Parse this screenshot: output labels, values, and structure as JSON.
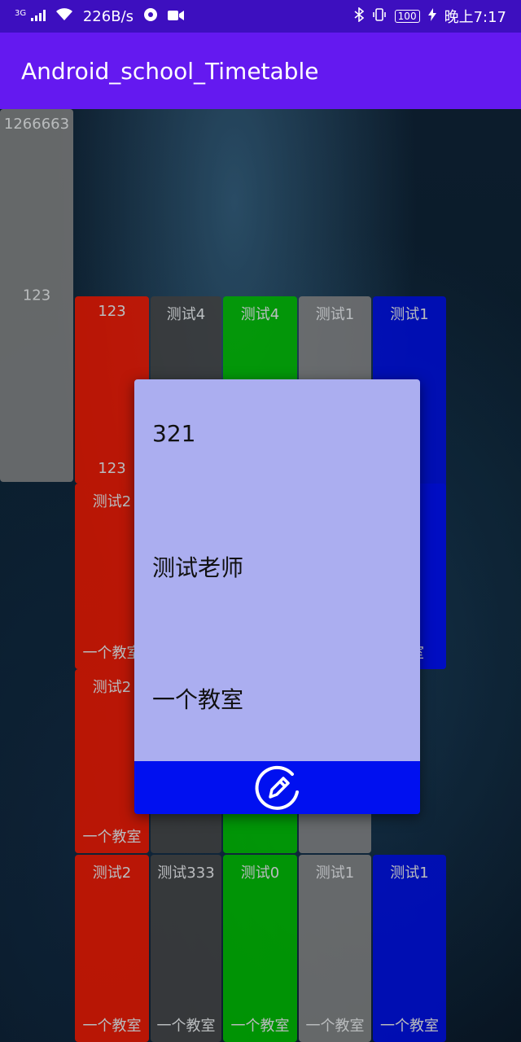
{
  "status_bar": {
    "network_type": "3G",
    "speed": "226B/s",
    "battery": "100",
    "time": "晚上7:17"
  },
  "app_bar": {
    "title": "Android_school_Timetable"
  },
  "timetable": {
    "cells": [
      {
        "top": "1266663",
        "mid": "123",
        "bot": "",
        "color": "#8c8c8c"
      },
      {
        "top": "123",
        "mid": "",
        "bot": "123",
        "color": "#ff1a00"
      },
      {
        "top": "测试4",
        "mid": "",
        "bot": "",
        "color": "#4a4a4a"
      },
      {
        "top": "测试4",
        "mid": "",
        "bot": "",
        "color": "#00c800"
      },
      {
        "top": "测试1",
        "mid": "",
        "bot": "",
        "color": "#8c8c8c"
      },
      {
        "top": "测试1",
        "mid": "",
        "bot": "教室",
        "color": "#0010f0"
      },
      {
        "top": "测试2",
        "mid": "",
        "bot": "一个教室",
        "color": "#ff1a00"
      },
      {
        "top": "",
        "mid": "",
        "bot": "教室",
        "color": "#0010f0"
      },
      {
        "top": "测试2",
        "mid": "",
        "bot": "一个教室",
        "color": "#ff1a00"
      },
      {
        "top": "",
        "mid": "",
        "bot": "",
        "color": "#4a4a4a"
      },
      {
        "top": "",
        "mid": "",
        "bot": "",
        "color": "#00c800"
      },
      {
        "top": "",
        "mid": "",
        "bot": "",
        "color": "#8c8c8c"
      },
      {
        "top": "测试2",
        "mid": "",
        "bot": "一个教室",
        "color": "#ff1a00"
      },
      {
        "top": "测试333",
        "mid": "",
        "bot": "一个教室",
        "color": "#4a4a4a"
      },
      {
        "top": "测试0",
        "mid": "",
        "bot": "一个教室",
        "color": "#00c800"
      },
      {
        "top": "测试1",
        "mid": "",
        "bot": "一个教室",
        "color": "#8c8c8c"
      },
      {
        "top": "测试1",
        "mid": "",
        "bot": "一个教室",
        "color": "#0010f0"
      }
    ]
  },
  "dialog": {
    "course_name": "321",
    "teacher": "测试老师",
    "classroom": "一个教室",
    "edit_icon": "edit-icon",
    "colors": {
      "body": "#abaef0",
      "footer": "#0010f0"
    }
  }
}
